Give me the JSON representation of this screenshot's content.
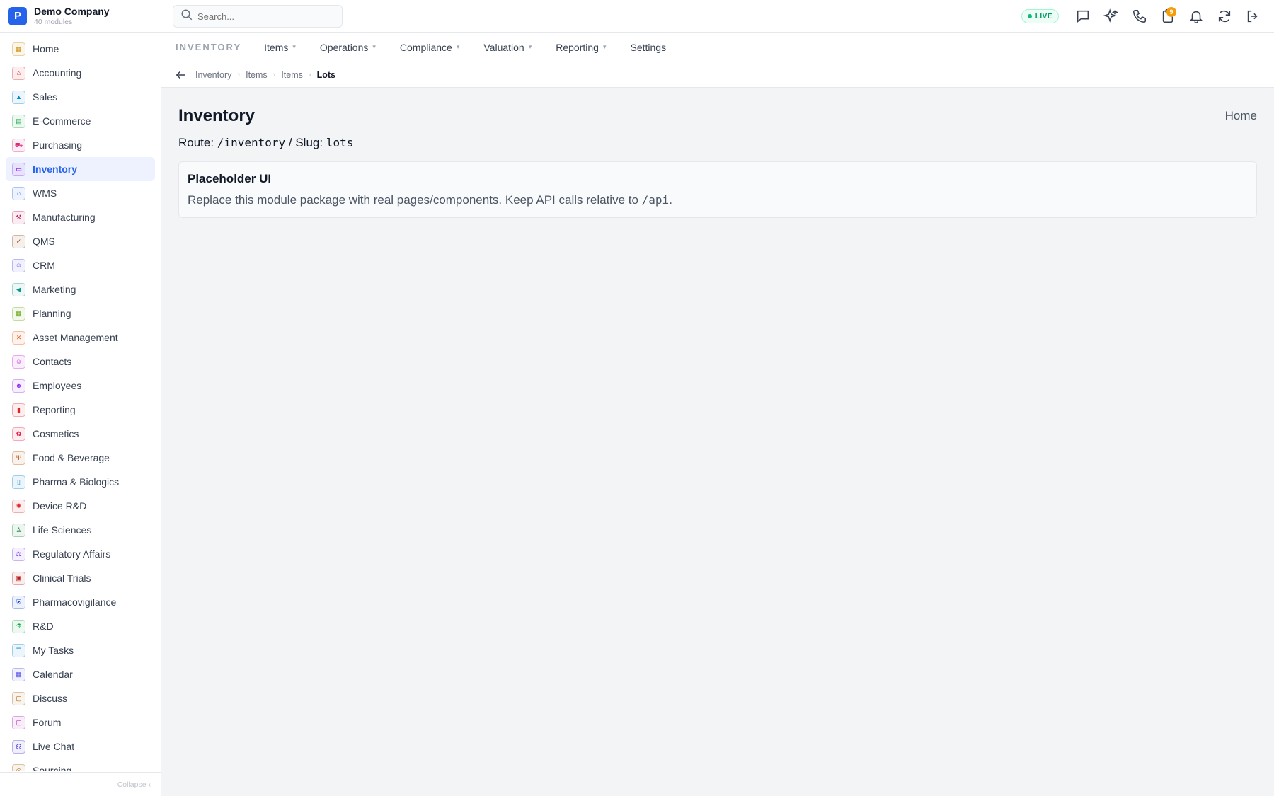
{
  "company": {
    "logo_letter": "P",
    "name": "Demo Company",
    "subtitle": "40 modules"
  },
  "sidebar": {
    "items": [
      {
        "label": "Home",
        "icon": "grid-icon",
        "glyph": "▦",
        "color": "#ca8a04"
      },
      {
        "label": "Accounting",
        "icon": "bank-icon",
        "glyph": "⌂",
        "color": "#dc2626"
      },
      {
        "label": "Sales",
        "icon": "sales-icon",
        "glyph": "▲",
        "color": "#0284c7"
      },
      {
        "label": "E-Commerce",
        "icon": "store-icon",
        "glyph": "▤",
        "color": "#16a34a"
      },
      {
        "label": "Purchasing",
        "icon": "cart-icon",
        "glyph": "⛟",
        "color": "#db2777"
      },
      {
        "label": "Inventory",
        "icon": "archive-icon",
        "glyph": "▭",
        "color": "#9333ea",
        "active": true
      },
      {
        "label": "WMS",
        "icon": "warehouse-icon",
        "glyph": "⌂",
        "color": "#2563eb"
      },
      {
        "label": "Manufacturing",
        "icon": "factory-icon",
        "glyph": "⚒",
        "color": "#be185d"
      },
      {
        "label": "QMS",
        "icon": "badge-check-icon",
        "glyph": "✓",
        "color": "#92400e"
      },
      {
        "label": "CRM",
        "icon": "users-icon",
        "glyph": "☺",
        "color": "#4f46e5"
      },
      {
        "label": "Marketing",
        "icon": "megaphone-icon",
        "glyph": "◀",
        "color": "#0d9488"
      },
      {
        "label": "Planning",
        "icon": "calendar-icon",
        "glyph": "▦",
        "color": "#65a30d"
      },
      {
        "label": "Asset Management",
        "icon": "tools-icon",
        "glyph": "✕",
        "color": "#ea580c"
      },
      {
        "label": "Contacts",
        "icon": "contact-icon",
        "glyph": "☺",
        "color": "#c026d3"
      },
      {
        "label": "Employees",
        "icon": "employee-icon",
        "glyph": "☻",
        "color": "#9333ea"
      },
      {
        "label": "Reporting",
        "icon": "bar-chart-icon",
        "glyph": "▮",
        "color": "#dc2626"
      },
      {
        "label": "Cosmetics",
        "icon": "flower-icon",
        "glyph": "✿",
        "color": "#e11d48"
      },
      {
        "label": "Food & Beverage",
        "icon": "utensils-icon",
        "glyph": "Ψ",
        "color": "#b45309"
      },
      {
        "label": "Pharma & Biologics",
        "icon": "pill-icon",
        "glyph": "▯",
        "color": "#0284c7"
      },
      {
        "label": "Device R&D",
        "icon": "cpu-icon",
        "glyph": "✺",
        "color": "#dc2626"
      },
      {
        "label": "Life Sciences",
        "icon": "microscope-icon",
        "glyph": "♙",
        "color": "#15803d"
      },
      {
        "label": "Regulatory Affairs",
        "icon": "gavel-icon",
        "glyph": "⚖",
        "color": "#7c3aed"
      },
      {
        "label": "Clinical Trials",
        "icon": "clipboard-icon",
        "glyph": "▣",
        "color": "#b91c1c"
      },
      {
        "label": "Pharmacovigilance",
        "icon": "shield-icon",
        "glyph": "⛨",
        "color": "#1d4ed8"
      },
      {
        "label": "R&D",
        "icon": "flask-icon",
        "glyph": "⚗",
        "color": "#16a34a"
      },
      {
        "label": "My Tasks",
        "icon": "checklist-icon",
        "glyph": "☰",
        "color": "#0284c7"
      },
      {
        "label": "Calendar",
        "icon": "calendar-days-icon",
        "glyph": "▦",
        "color": "#4f46e5"
      },
      {
        "label": "Discuss",
        "icon": "chat-icon",
        "glyph": "▢",
        "color": "#a16207"
      },
      {
        "label": "Forum",
        "icon": "forum-icon",
        "glyph": "▢",
        "color": "#a21caf"
      },
      {
        "label": "Live Chat",
        "icon": "headset-icon",
        "glyph": "☊",
        "color": "#4338ca"
      },
      {
        "label": "Sourcing",
        "icon": "sourcing-icon",
        "glyph": "◎",
        "color": "#a16207"
      }
    ],
    "collapse_label": "Collapse ‹"
  },
  "topbar": {
    "search_placeholder": "Search...",
    "live_label": "LIVE",
    "notification_count": "9",
    "icons": [
      "message-icon",
      "sparkles-icon",
      "phone-icon",
      "clipboard-bell-icon",
      "bell-icon",
      "refresh-icon",
      "logout-icon"
    ]
  },
  "module": {
    "title": "INVENTORY",
    "menu": [
      {
        "label": "Items",
        "dropdown": true
      },
      {
        "label": "Operations",
        "dropdown": true
      },
      {
        "label": "Compliance",
        "dropdown": true
      },
      {
        "label": "Valuation",
        "dropdown": true
      },
      {
        "label": "Reporting",
        "dropdown": true
      },
      {
        "label": "Settings",
        "dropdown": false
      }
    ]
  },
  "breadcrumb": [
    "Inventory",
    "Items",
    "Items",
    "Lots"
  ],
  "page": {
    "title": "Inventory",
    "home_link": "Home",
    "route_label": "Route:",
    "route_value": "/inventory",
    "slug_label": "/ Slug:",
    "slug_value": "lots",
    "card_title": "Placeholder UI",
    "card_text_prefix": "Replace this module package with real pages/components. Keep API calls relative to",
    "card_text_code": "/api",
    "card_text_suffix": "."
  },
  "colors": {
    "accent": "#2563eb",
    "live": "#10b981",
    "badge": "#f59e0b"
  }
}
